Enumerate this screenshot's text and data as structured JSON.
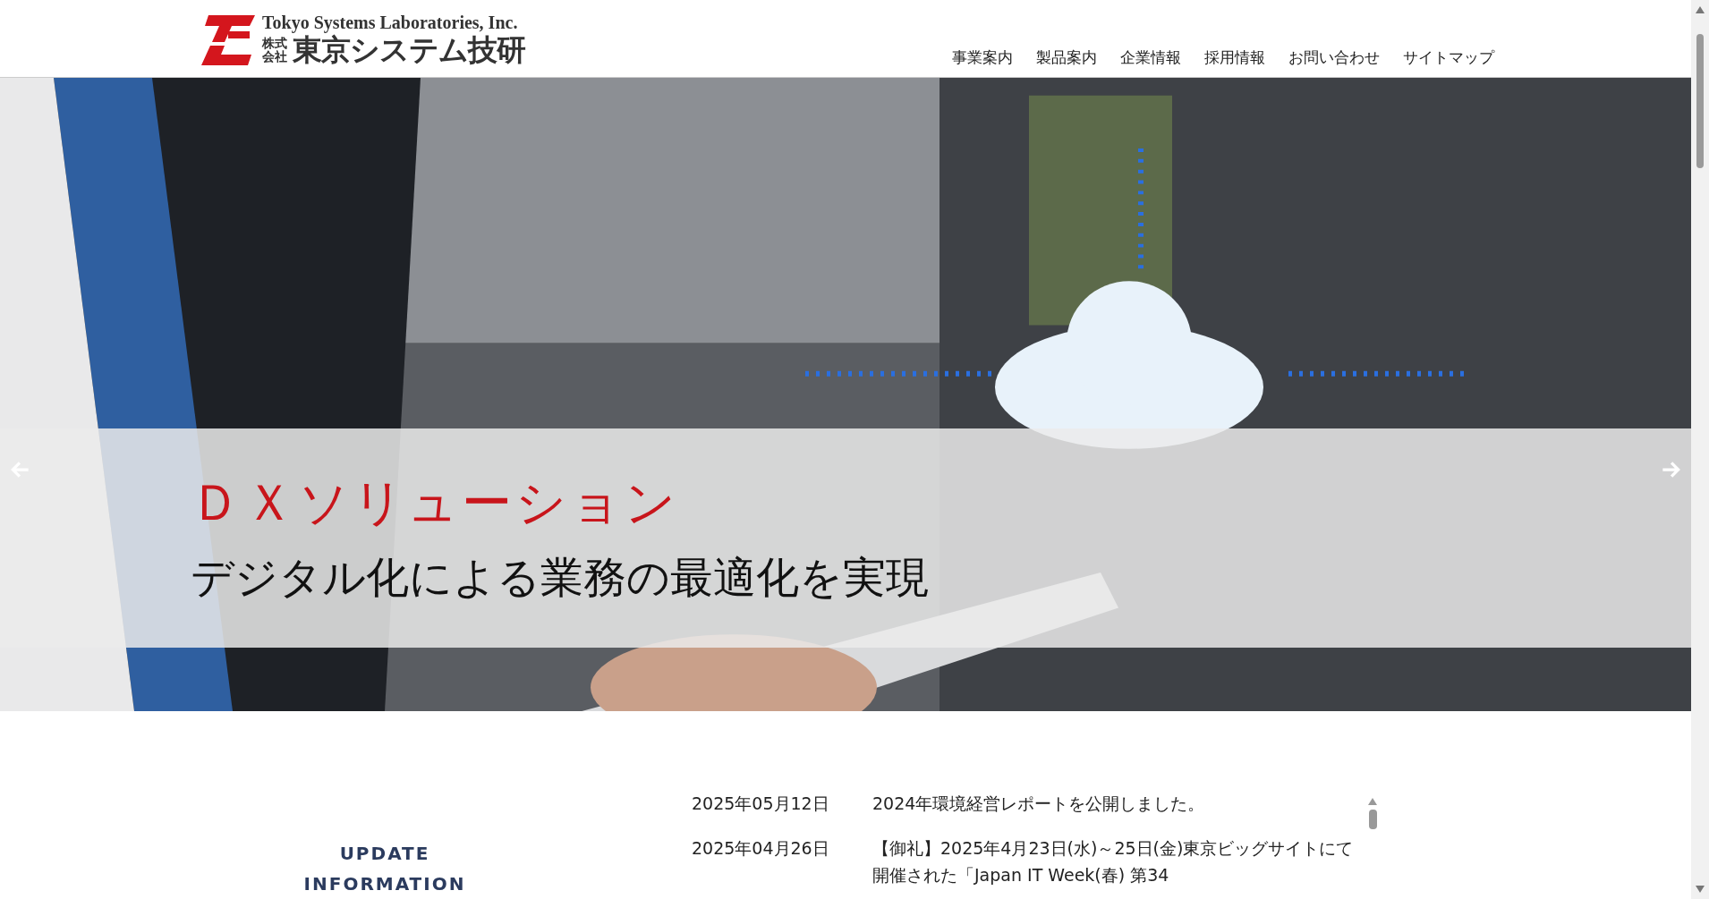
{
  "header": {
    "logo": {
      "english_name": "Tokyo Systems Laboratories, Inc.",
      "corporate_prefix": [
        "株式",
        "会社"
      ],
      "japanese_name": "東京システム技研"
    },
    "nav": [
      "事業案内",
      "製品案内",
      "企業情報",
      "採用情報",
      "お問い合わせ",
      "サイトマップ"
    ]
  },
  "hero": {
    "kind": "picture",
    "caption": {
      "title": "ＤＸソリューション",
      "subtitle": "デジタル化による業務の最適化を実現"
    }
  },
  "updates": {
    "heading": [
      "UPDATE",
      "INFORMATION"
    ],
    "items": [
      {
        "date": "2025年05月12日",
        "text": "2024年環境経営レポートを公開しました。"
      },
      {
        "date": "2025年04月26日",
        "text": "【御礼】2025年4月23日(水)～25日(金)東京ビッグサイトにて開催された「Japan IT Week(春) 第34"
      }
    ]
  }
}
